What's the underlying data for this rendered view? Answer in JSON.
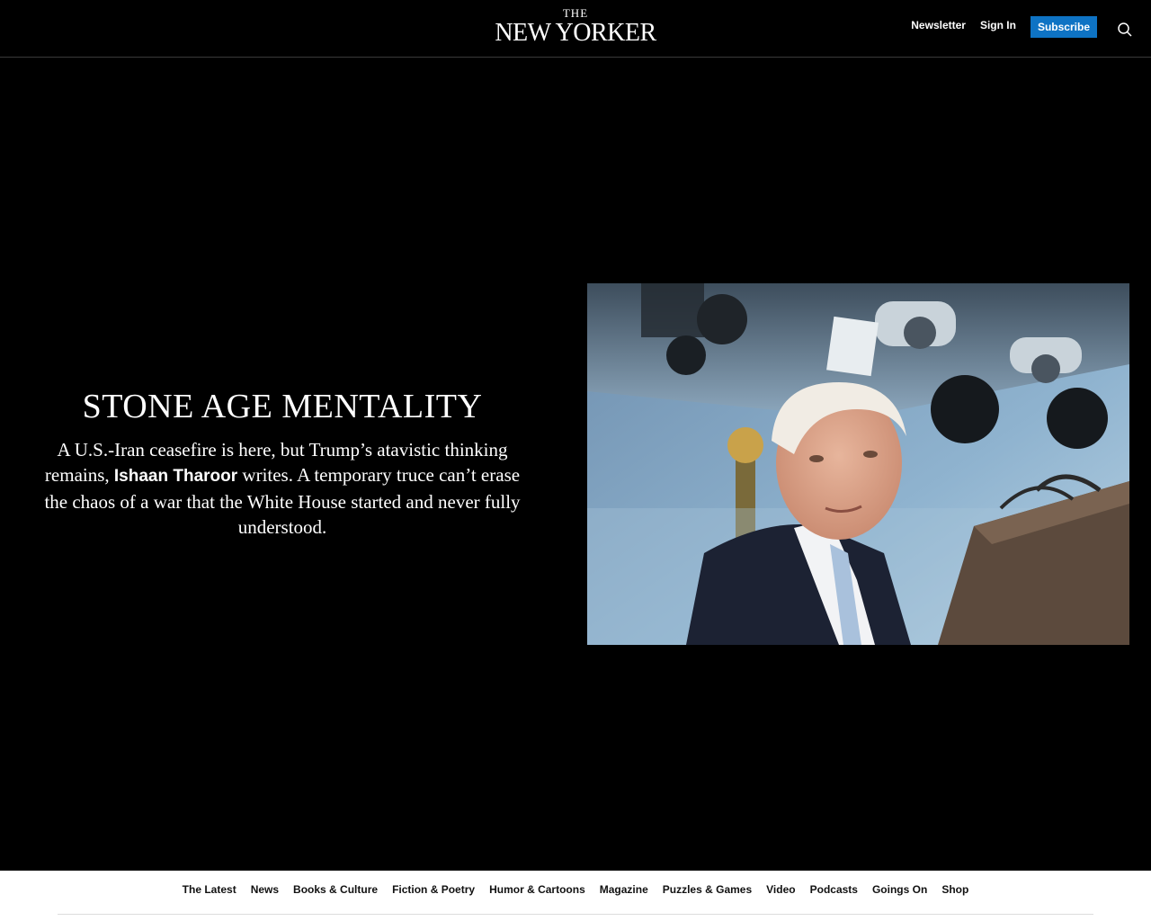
{
  "header": {
    "logo_the": "THE",
    "logo_main": "NEW YORKER",
    "newsletter_label": "Newsletter",
    "signin_label": "Sign In",
    "subscribe_label": "Subscribe",
    "search_icon": "search-icon",
    "subscribe_color": "#0e73c4"
  },
  "hero": {
    "headline": "STONE AGE MENTALITY",
    "dek_before": "A U.S.-Iran ceasefire is here, but Trump’s atavistic thinking remains, ",
    "author": "Ishaan Tharoor",
    "dek_after": " writes. A temporary truce can’t erase the chaos of a war that the White House started and never fully understood."
  },
  "bottom_nav": {
    "items": [
      "The Latest",
      "News",
      "Books & Culture",
      "Fiction & Poetry",
      "Humor & Cartoons",
      "Magazine",
      "Puzzles & Games",
      "Video",
      "Podcasts",
      "Goings On",
      "Shop"
    ]
  }
}
